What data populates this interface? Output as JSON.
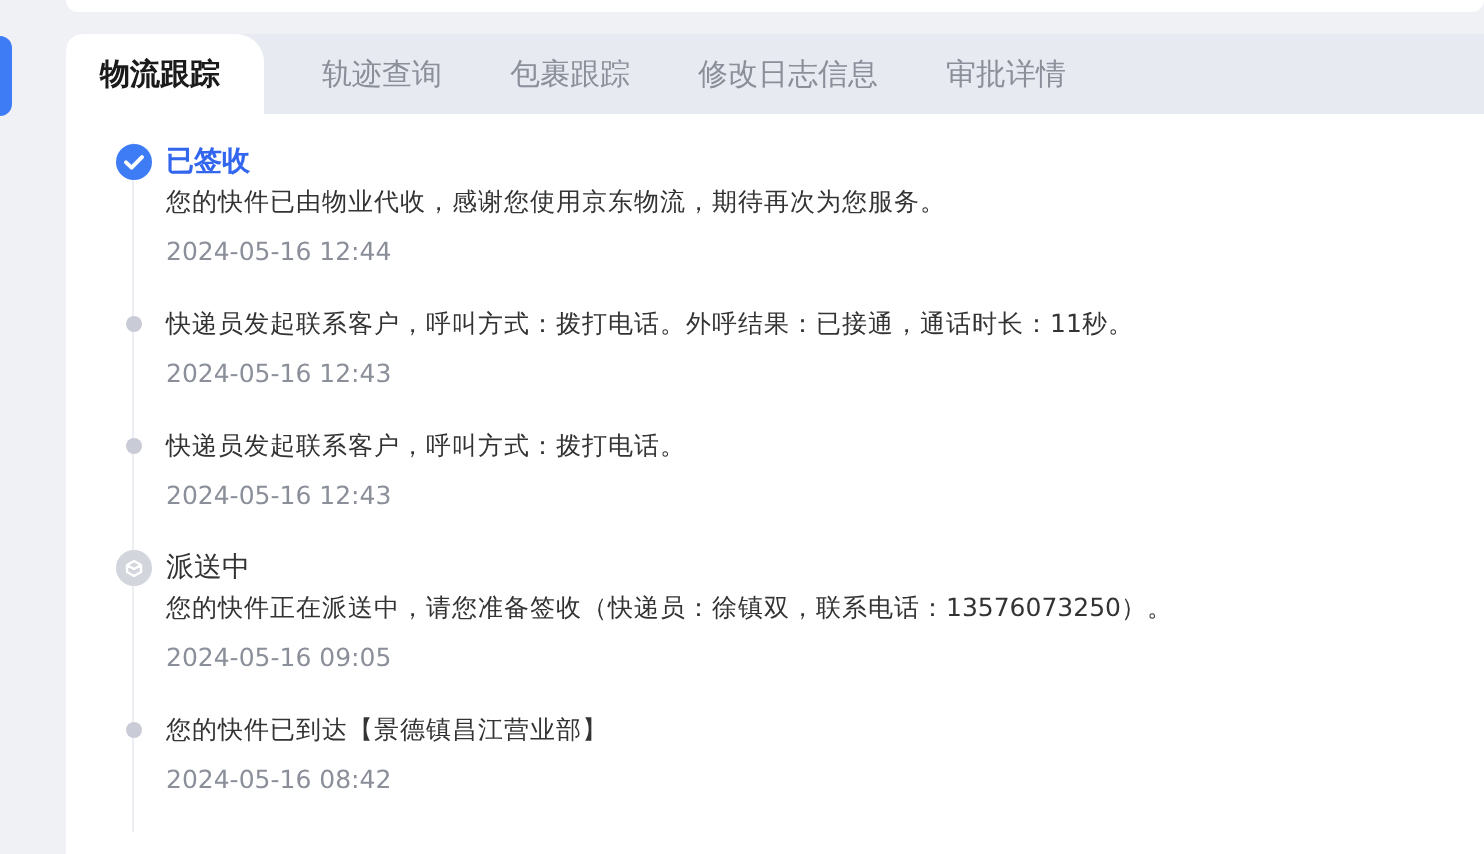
{
  "tabs": [
    {
      "label": "物流跟踪",
      "selected": true
    },
    {
      "label": "轨迹查询",
      "selected": false
    },
    {
      "label": "包裹跟踪",
      "selected": false
    },
    {
      "label": "修改日志信息",
      "selected": false
    },
    {
      "label": "审批详情",
      "selected": false
    }
  ],
  "events": [
    {
      "kind": "milestone",
      "done": true,
      "title": "已签收",
      "text": "您的快件已由物业代收，感谢您使用京东物流，期待再次为您服务。",
      "time": "2024-05-16 12:44"
    },
    {
      "kind": "note",
      "text": "快递员发起联系客户，呼叫方式：拨打电话。外呼结果：已接通，通话时长：11秒。",
      "time": "2024-05-16 12:43"
    },
    {
      "kind": "note",
      "text": "快递员发起联系客户，呼叫方式：拨打电话。",
      "time": "2024-05-16 12:43"
    },
    {
      "kind": "milestone",
      "done": false,
      "title": "派送中",
      "text": "您的快件正在派送中，请您准备签收（快递员：徐镇双，联系电话：13576073250）。",
      "time": "2024-05-16 09:05"
    },
    {
      "kind": "note",
      "text": "您的快件已到达【景德镇昌江营业部】",
      "time": "2024-05-16 08:42"
    }
  ]
}
